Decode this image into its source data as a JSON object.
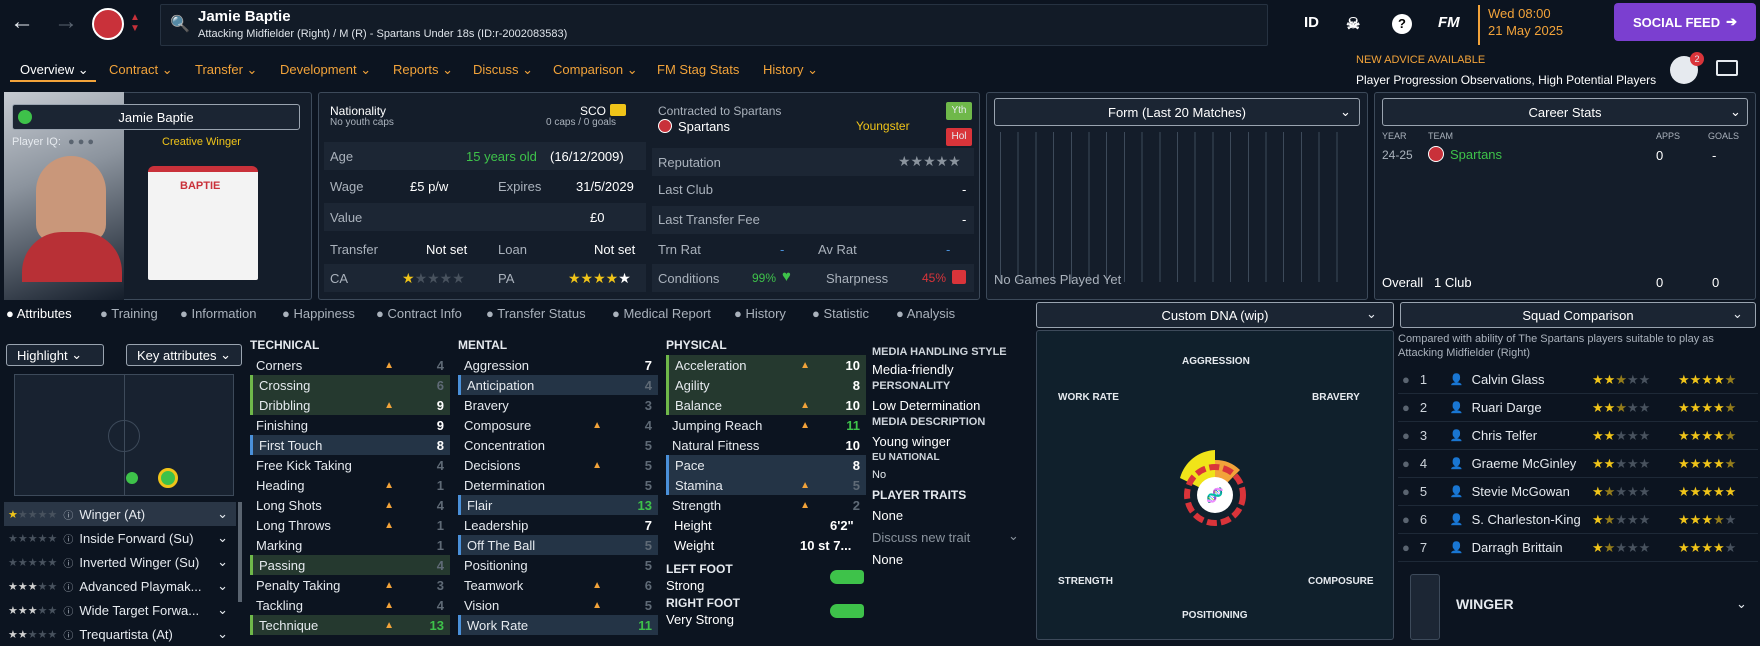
{
  "header": {
    "player_name": "Jamie Baptie",
    "subtitle": "Attacking Midfielder (Right) / M (R) - Spartans Under 18s (ID:r-2002083583)",
    "id_label": "ID",
    "fm_label": "FM",
    "date_time": "Wed 08:00",
    "date": "21 May 2025",
    "social_feed": "SOCIAL FEED",
    "advice_title": "NEW ADVICE AVAILABLE",
    "advice_text": "Player Progression Observations, High Potential Players",
    "notif_count": "2"
  },
  "menu": [
    "Overview",
    "Contract",
    "Transfer",
    "Development",
    "Reports",
    "Discuss",
    "Comparison",
    "FM Stag Stats",
    "History"
  ],
  "profile": {
    "name": "Jamie Baptie",
    "player_iq_label": "Player IQ:",
    "role_tag": "Creative Winger",
    "shirt_name": "BAPTIE"
  },
  "bio": {
    "nationality_label": "Nationality",
    "nationality_value": "SCO",
    "youth_caps": "No youth caps",
    "caps": "0 caps / 0 goals",
    "age_label": "Age",
    "age_value": "15 years old",
    "dob": "(16/12/2009)",
    "wage_label": "Wage",
    "wage_value": "£5 p/w",
    "expires_label": "Expires",
    "expires_value": "31/5/2029",
    "value_label": "Value",
    "value_value": "£0",
    "transfer_label": "Transfer",
    "transfer_value": "Not set",
    "loan_label": "Loan",
    "loan_value": "Not set",
    "ca_label": "CA",
    "pa_label": "PA"
  },
  "contract": {
    "contracted_label": "Contracted to Spartans",
    "club": "Spartans",
    "status": "Youngster",
    "yth_badge": "Yth",
    "hol_badge": "Hol",
    "reputation_label": "Reputation",
    "last_club_label": "Last Club",
    "last_club_value": "-",
    "last_fee_label": "Last Transfer Fee",
    "last_fee_value": "-",
    "trn_rat_label": "Trn Rat",
    "trn_rat_value": "-",
    "av_rat_label": "Av Rat",
    "av_rat_value": "-",
    "conditions_label": "Conditions",
    "conditions_value": "99%",
    "sharpness_label": "Sharpness",
    "sharpness_value": "45%"
  },
  "form": {
    "title": "Form (Last 20 Matches)",
    "empty": "No Games Played Yet"
  },
  "career": {
    "title": "Career Stats",
    "col_year": "YEAR",
    "col_team": "TEAM",
    "col_apps": "APPS",
    "col_goals": "GOALS",
    "row_year": "24-25",
    "row_team": "Spartans",
    "row_apps": "0",
    "row_goals": "-",
    "total_label": "Overall",
    "total_clubs": "1 Club",
    "total_apps": "0",
    "total_goals": "0"
  },
  "tabs": [
    "Attributes",
    "Training",
    "Information",
    "Happiness",
    "Contract Info",
    "Transfer Status",
    "Medical Report",
    "History",
    "Statistic",
    "Analysis"
  ],
  "controls": {
    "highlight": "Highlight",
    "key_attributes": "Key attributes"
  },
  "roles": [
    {
      "name": "Winger (At)"
    },
    {
      "name": "Inside Forward (Su)"
    },
    {
      "name": "Inverted Winger (Su)"
    },
    {
      "name": "Advanced Playmak..."
    },
    {
      "name": "Wide Target Forwa..."
    },
    {
      "name": "Trequartista (At)"
    }
  ],
  "technical": {
    "title": "TECHNICAL",
    "items": [
      [
        "Corners",
        "4"
      ],
      [
        "Crossing",
        "6"
      ],
      [
        "Dribbling",
        "9"
      ],
      [
        "Finishing",
        "9"
      ],
      [
        "First Touch",
        "8"
      ],
      [
        "Free Kick Taking",
        "4"
      ],
      [
        "Heading",
        "1"
      ],
      [
        "Long Shots",
        "4"
      ],
      [
        "Long Throws",
        "1"
      ],
      [
        "Marking",
        "1"
      ],
      [
        "Passing",
        "4"
      ],
      [
        "Penalty Taking",
        "3"
      ],
      [
        "Tackling",
        "4"
      ],
      [
        "Technique",
        "13"
      ]
    ]
  },
  "mental": {
    "title": "MENTAL",
    "items": [
      [
        "Aggression",
        "7"
      ],
      [
        "Anticipation",
        "4"
      ],
      [
        "Bravery",
        "3"
      ],
      [
        "Composure",
        "4"
      ],
      [
        "Concentration",
        "5"
      ],
      [
        "Decisions",
        "5"
      ],
      [
        "Determination",
        "5"
      ],
      [
        "Flair",
        "13"
      ],
      [
        "Leadership",
        "7"
      ],
      [
        "Off The Ball",
        "5"
      ],
      [
        "Positioning",
        "5"
      ],
      [
        "Teamwork",
        "6"
      ],
      [
        "Vision",
        "5"
      ],
      [
        "Work Rate",
        "11"
      ]
    ]
  },
  "physical": {
    "title": "PHYSICAL",
    "items": [
      [
        "Acceleration",
        "10"
      ],
      [
        "Agility",
        "8"
      ],
      [
        "Balance",
        "10"
      ],
      [
        "Jumping Reach",
        "11"
      ],
      [
        "Natural Fitness",
        "10"
      ],
      [
        "Pace",
        "8"
      ],
      [
        "Stamina",
        "5"
      ],
      [
        "Strength",
        "2"
      ]
    ],
    "height_label": "Height",
    "height_value": "6'2\"",
    "weight_label": "Weight",
    "weight_value": "10 st 7...",
    "left_foot_label": "LEFT FOOT",
    "left_foot_value": "Strong",
    "right_foot_label": "RIGHT FOOT",
    "right_foot_value": "Very Strong"
  },
  "media": {
    "style_label": "MEDIA HANDLING STYLE",
    "style_value": "Media-friendly",
    "personality_label": "PERSONALITY",
    "personality_value": "Low Determination",
    "desc_label": "MEDIA DESCRIPTION",
    "desc_value": "Young winger",
    "eu_label": "EU NATIONAL",
    "eu_value": "No",
    "traits_label": "PLAYER TRAITS",
    "traits_value": "None",
    "discuss": "Discuss new trait",
    "discuss_value": "None"
  },
  "dna": {
    "title": "Custom DNA (wip)",
    "aggression": "AGGRESSION",
    "work_rate": "WORK RATE",
    "bravery": "BRAVERY",
    "strength": "STRENGTH",
    "composure": "COMPOSURE",
    "positioning": "POSITIONING"
  },
  "squad": {
    "title": "Squad Comparison",
    "desc": "Compared with ability of The Spartans players suitable to play as Attacking Midfielder (Right)",
    "players": [
      [
        "1",
        "Calvin Glass"
      ],
      [
        "2",
        "Ruari Darge"
      ],
      [
        "3",
        "Chris Telfer"
      ],
      [
        "4",
        "Graeme McGinley"
      ],
      [
        "5",
        "Stevie McGowan"
      ],
      [
        "6",
        "S. Charleston-King"
      ],
      [
        "7",
        "Darragh Brittain"
      ]
    ],
    "position": "WINGER"
  },
  "colors": {
    "accent": "#f2a33a",
    "social": "#7b3fd0",
    "green": "#3ec24a",
    "red": "#d9343a"
  }
}
